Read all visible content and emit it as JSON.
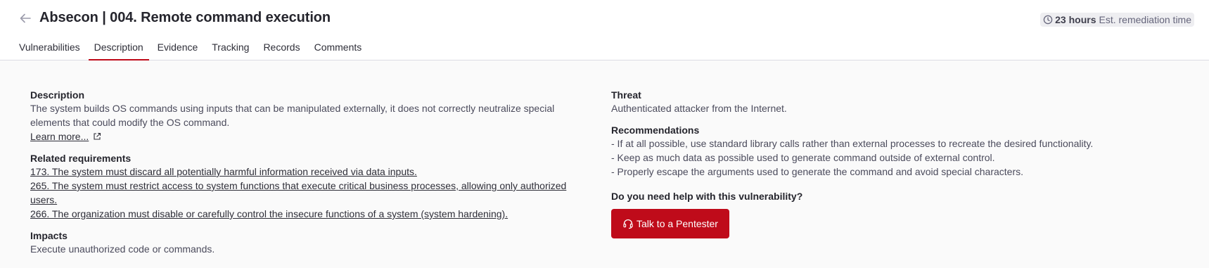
{
  "header": {
    "title": "Absecon | 004. Remote command execution",
    "remediation_value": "23 hours",
    "remediation_label": "Est. remediation time"
  },
  "tabs": [
    {
      "label": "Vulnerabilities"
    },
    {
      "label": "Description"
    },
    {
      "label": "Evidence"
    },
    {
      "label": "Tracking"
    },
    {
      "label": "Records"
    },
    {
      "label": "Comments"
    }
  ],
  "active_tab": "Description",
  "description": {
    "heading": "Description",
    "text": "The system builds OS commands using inputs that can be manipulated externally, it does not correctly neutralize special elements that could modify the OS command.",
    "learn_more": "Learn more..."
  },
  "requirements": {
    "heading": "Related requirements",
    "items": [
      "173. The system must discard all potentially harmful information received via data inputs.",
      "265. The system must restrict access to system functions that execute critical business processes, allowing only authorized users.",
      "266. The organization must disable or carefully control the insecure functions of a system (system hardening)."
    ]
  },
  "impacts": {
    "heading": "Impacts",
    "text": "Execute unauthorized code or commands."
  },
  "threat": {
    "heading": "Threat",
    "text": "Authenticated attacker from the Internet."
  },
  "recommendations": {
    "heading": "Recommendations",
    "items": [
      "- If at all possible, use standard library calls rather than external processes to recreate the desired functionality.",
      "- Keep as much data as possible used to generate command outside of external control.",
      "- Properly escape the arguments used to generate the command and avoid special characters."
    ]
  },
  "help": {
    "question": "Do you need help with this vulnerability?",
    "button_label": "Talk to a Pentester"
  },
  "colors": {
    "accent": "#bf0b1a",
    "background": "#fafafa",
    "header_bg": "#ffffff"
  },
  "icons": {
    "back": "arrow-left-icon",
    "clock": "clock-icon",
    "external": "external-link-icon",
    "headset": "headset-icon"
  }
}
